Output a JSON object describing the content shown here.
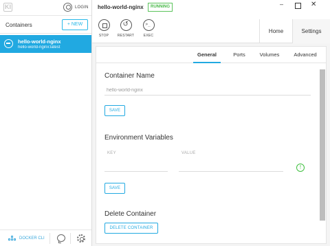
{
  "sidebar": {
    "logo_text": "KI",
    "login_label": "LOGIN",
    "containers_title": "Containers",
    "new_label": "+ NEW",
    "items": [
      {
        "name": "hello-world-nginx",
        "image": "hello-world-nginx:latest"
      }
    ],
    "docker_cli_label": "DOCKER CLI"
  },
  "header": {
    "container_name": "hello-world-nginx",
    "status": "RUNNING",
    "window_min": "–",
    "window_close": "✕",
    "actions": {
      "stop": "STOP",
      "restart": "RESTART",
      "exec": "EXEC"
    },
    "tabs": {
      "home": "Home",
      "settings": "Settings"
    }
  },
  "settings": {
    "subtabs": {
      "general": "General",
      "ports": "Ports",
      "volumes": "Volumes",
      "advanced": "Advanced"
    },
    "container_name_section": {
      "title": "Container Name",
      "value": "hello-world-nginx",
      "save_label": "SAVE"
    },
    "env_section": {
      "title": "Environment Variables",
      "key_header": "KEY",
      "value_header": "VALUE",
      "add_icon": "!",
      "save_label": "SAVE"
    },
    "delete_section": {
      "title": "Delete Container",
      "button_label": "DELETE CONTAINER"
    }
  },
  "colors": {
    "accent": "#21a9e1",
    "running": "#47b847",
    "add": "#3fbf3f"
  }
}
